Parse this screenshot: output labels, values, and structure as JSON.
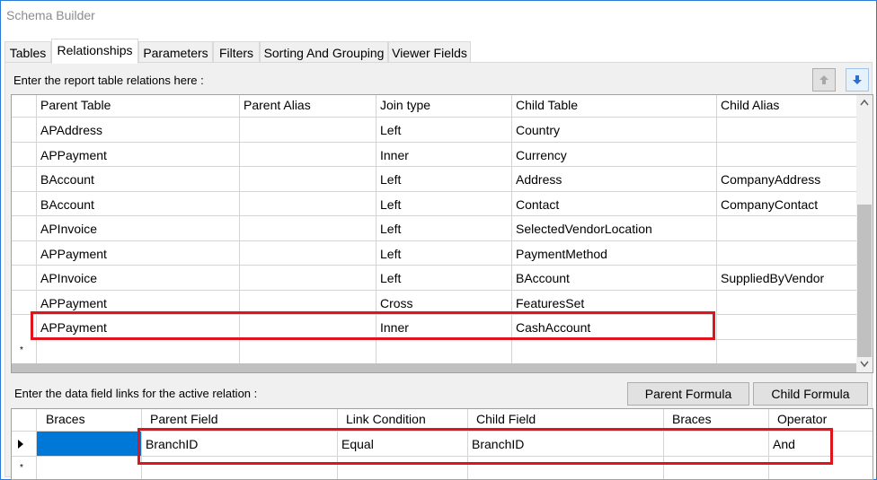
{
  "window": {
    "title": "Schema Builder"
  },
  "tabs": [
    {
      "label": "Tables"
    },
    {
      "label": "Relationships"
    },
    {
      "label": "Parameters"
    },
    {
      "label": "Filters"
    },
    {
      "label": "Sorting And Grouping"
    },
    {
      "label": "Viewer Fields"
    }
  ],
  "relations": {
    "instruction": "Enter the report table relations here :",
    "columns": [
      "Parent Table",
      "Parent Alias",
      "Join type",
      "Child Table",
      "Child Alias"
    ],
    "rows": [
      [
        "APAddress",
        "",
        "Left",
        "Country",
        ""
      ],
      [
        "APPayment",
        "",
        "Inner",
        "Currency",
        ""
      ],
      [
        "BAccount",
        "",
        "Left",
        "Address",
        "CompanyAddress"
      ],
      [
        "BAccount",
        "",
        "Left",
        "Contact",
        "CompanyContact"
      ],
      [
        "APInvoice",
        "",
        "Left",
        "SelectedVendorLocation",
        ""
      ],
      [
        "APPayment",
        "",
        "Left",
        "PaymentMethod",
        ""
      ],
      [
        "APInvoice",
        "",
        "Left",
        "BAccount",
        "SuppliedByVendor"
      ],
      [
        "APPayment",
        "",
        "Cross",
        "FeaturesSet",
        ""
      ],
      [
        "APPayment",
        "",
        "Inner",
        "CashAccount",
        ""
      ]
    ],
    "new_row_marker": "*"
  },
  "links": {
    "instruction": "Enter the data field links for the active relation :",
    "parent_formula_label": "Parent Formula",
    "child_formula_label": "Child Formula",
    "columns": [
      "Braces",
      "Parent Field",
      "Link Condition",
      "Child Field",
      "Braces",
      "Operator"
    ],
    "rows": [
      [
        "",
        "BranchID",
        "Equal",
        "BranchID",
        "",
        "And"
      ]
    ],
    "new_row_marker": "*"
  },
  "colors": {
    "accent": "#0078d7",
    "highlight": "#e0141c",
    "window_border": "#2b79d8"
  },
  "icons": {
    "move_up": "up-arrow-icon",
    "move_down": "down-arrow-icon"
  }
}
